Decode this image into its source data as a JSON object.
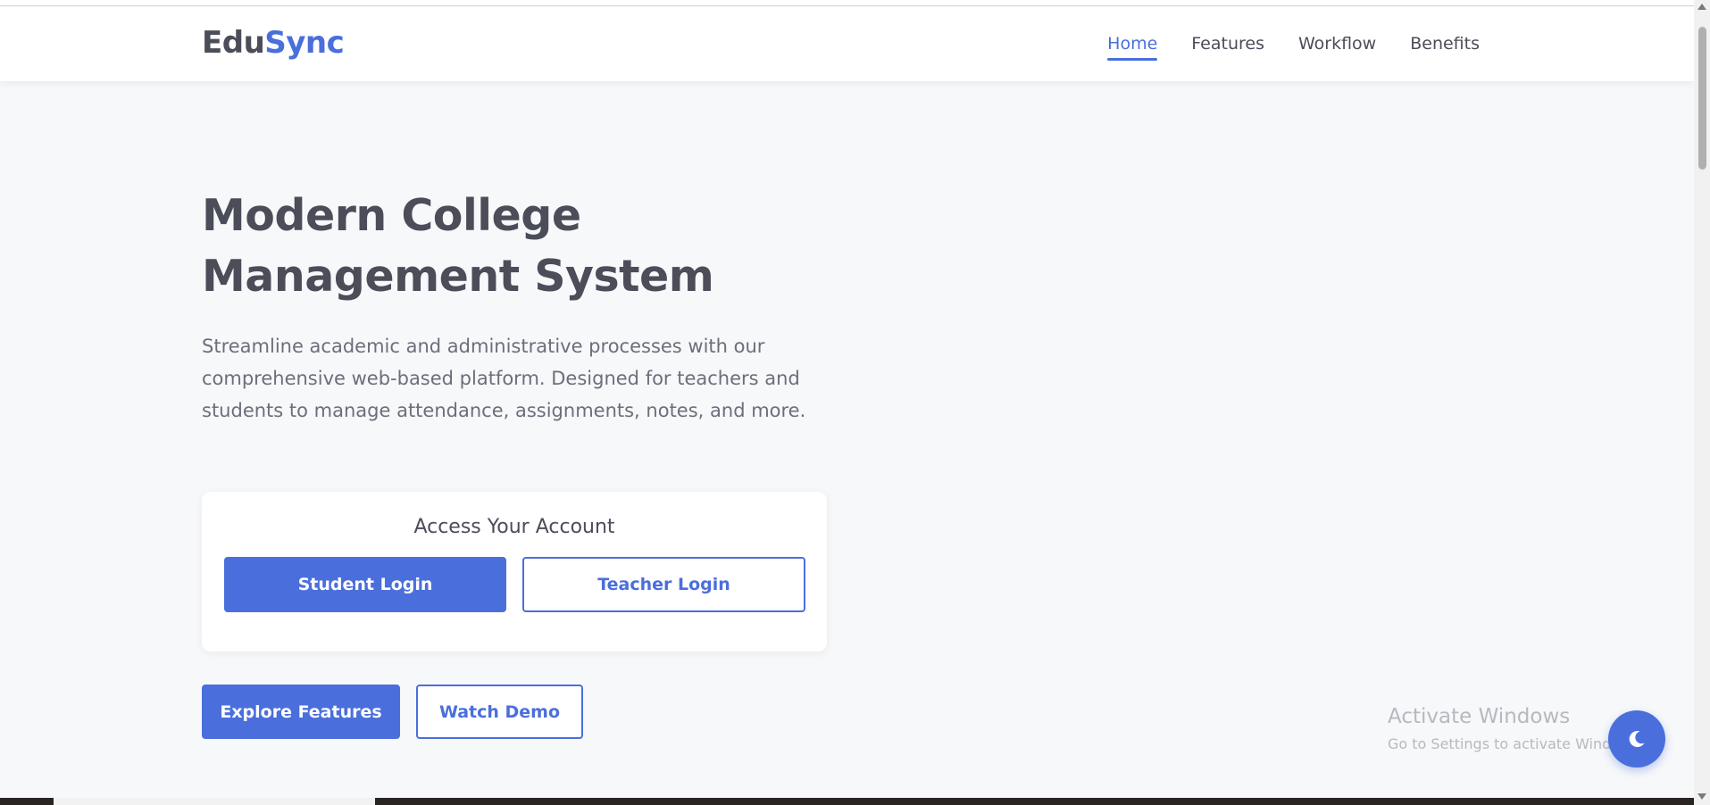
{
  "brand": {
    "part1": "Edu",
    "part2": "Sync"
  },
  "nav": {
    "items": [
      {
        "label": "Home",
        "active": true
      },
      {
        "label": "Features",
        "active": false
      },
      {
        "label": "Workflow",
        "active": false
      },
      {
        "label": "Benefits",
        "active": false
      }
    ]
  },
  "hero": {
    "title_line1": "Modern College",
    "title_line2": "Management System",
    "description": "Streamline academic and administrative processes with our comprehensive web-based platform. Designed for teachers and students to manage attendance, assignments, notes, and more."
  },
  "account": {
    "title": "Access Your Account",
    "student_label": "Student Login",
    "teacher_label": "Teacher Login"
  },
  "cta": {
    "explore_label": "Explore Features",
    "demo_label": "Watch Demo"
  },
  "watermark": {
    "title": "Activate Windows",
    "subtitle": "Go to Settings to activate Windows."
  },
  "theme_toggle": {
    "icon": "moon-icon"
  },
  "colors": {
    "accent": "#4a6fdc",
    "text": "#4b4d59",
    "muted": "#6c6e7a",
    "background": "#f7f8fa"
  }
}
